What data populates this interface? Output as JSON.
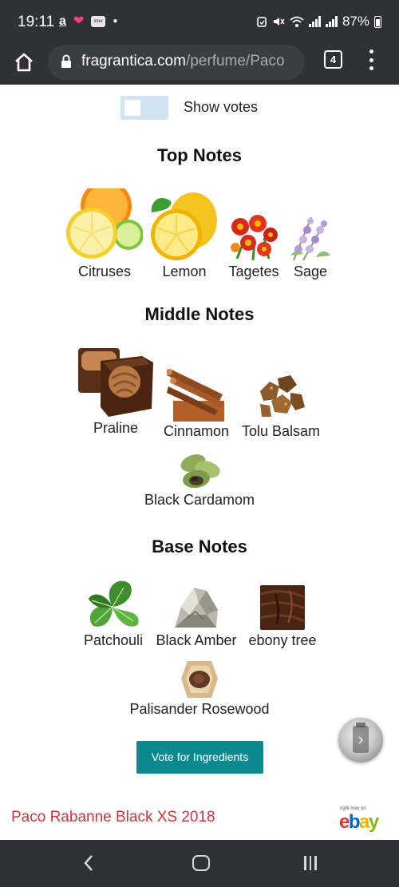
{
  "status_bar": {
    "time": "19:11",
    "left_icons": [
      "amazon-icon",
      "heart-icon",
      "inter-app-icon",
      "dot-icon"
    ],
    "inter_badge": "inter",
    "battery": "87%",
    "right_icons": [
      "alarm-icon",
      "mute-icon",
      "wifi-icon",
      "signal-icon",
      "signal-icon",
      "battery-icon"
    ]
  },
  "browser": {
    "url_host": "fragrantica.com",
    "url_path": "/perfume/Paco",
    "tab_count": "4"
  },
  "votes_toggle": {
    "label": "Show votes",
    "on": false
  },
  "sections": {
    "top": {
      "title": "Top Notes",
      "notes": [
        {
          "name": "Citruses",
          "icon": "citrus-slices-icon"
        },
        {
          "name": "Lemon",
          "icon": "lemon-icon"
        },
        {
          "name": "Tagetes",
          "icon": "marigold-flowers-icon"
        },
        {
          "name": "Sage",
          "icon": "sage-flowers-icon"
        }
      ]
    },
    "middle": {
      "title": "Middle Notes",
      "notes": [
        {
          "name": "Praline",
          "icon": "chocolate-praline-icon"
        },
        {
          "name": "Cinnamon",
          "icon": "cinnamon-sticks-icon"
        },
        {
          "name": "Tolu Balsam",
          "icon": "resin-chunks-icon"
        },
        {
          "name": "Black Cardamom",
          "icon": "cardamom-pods-icon"
        }
      ]
    },
    "base": {
      "title": "Base Notes",
      "notes": [
        {
          "name": "Patchouli",
          "icon": "patchouli-leaves-icon"
        },
        {
          "name": "Black Amber",
          "icon": "amber-stone-icon"
        },
        {
          "name": "ebony tree",
          "icon": "ebony-wood-icon"
        },
        {
          "name": "Palisander Rosewood",
          "icon": "rosewood-log-icon"
        }
      ]
    }
  },
  "vote_button": {
    "label": "Vote for Ingredients"
  },
  "footer": {
    "perfume_link": "Paco Rabanne Black XS 2018",
    "ebay_tagline": "right now on",
    "ebay_letters": [
      "e",
      "b",
      "a",
      "y"
    ]
  },
  "colors": {
    "chrome_dark": "#303134",
    "toggle_track": "#d3e3f3",
    "vote_button_bg": "#0a8a8e",
    "footer_link": "#c8373b",
    "ebay_e": "#e53238",
    "ebay_b": "#0064d2",
    "ebay_a": "#f5af02",
    "ebay_y": "#86b817"
  }
}
